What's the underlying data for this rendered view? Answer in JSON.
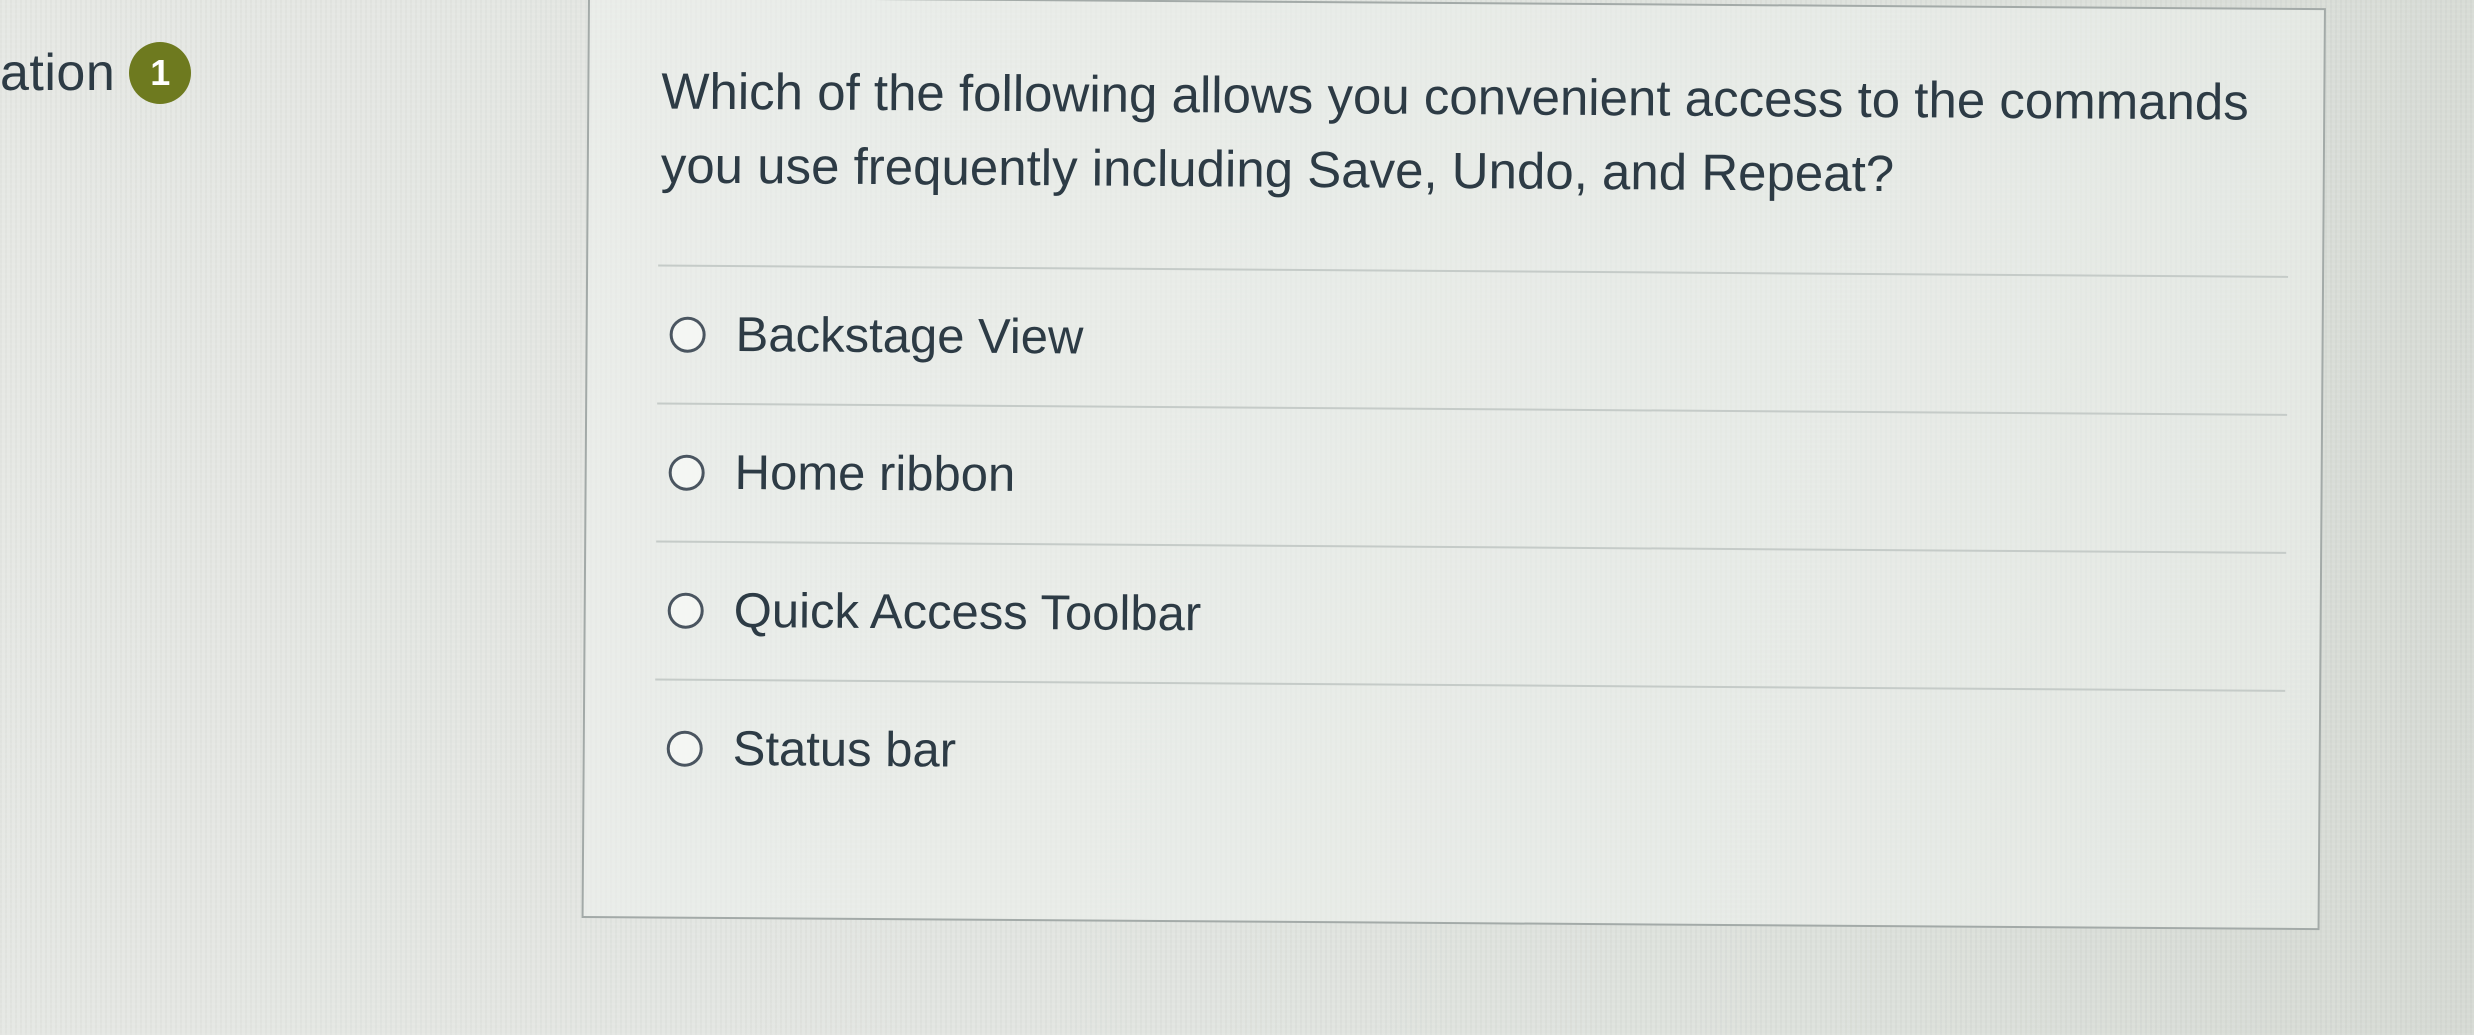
{
  "sidebar": {
    "heading_fragment": "ation",
    "badge_count": "1"
  },
  "question": {
    "text": "Which of the following allows you convenient access to the commands you use frequently including Save, Undo, and Repeat?",
    "options": [
      {
        "label": "Backstage View",
        "selected": false
      },
      {
        "label": "Home ribbon",
        "selected": false
      },
      {
        "label": "Quick Access Toolbar",
        "selected": false
      },
      {
        "label": "Status bar",
        "selected": false
      }
    ]
  },
  "colors": {
    "badge": "#6e7a1f",
    "text": "#2d3b45",
    "card_border": "#a3aaa8"
  },
  "icons": {
    "option_marker": "radio-circle-icon",
    "badge": "count-badge"
  }
}
